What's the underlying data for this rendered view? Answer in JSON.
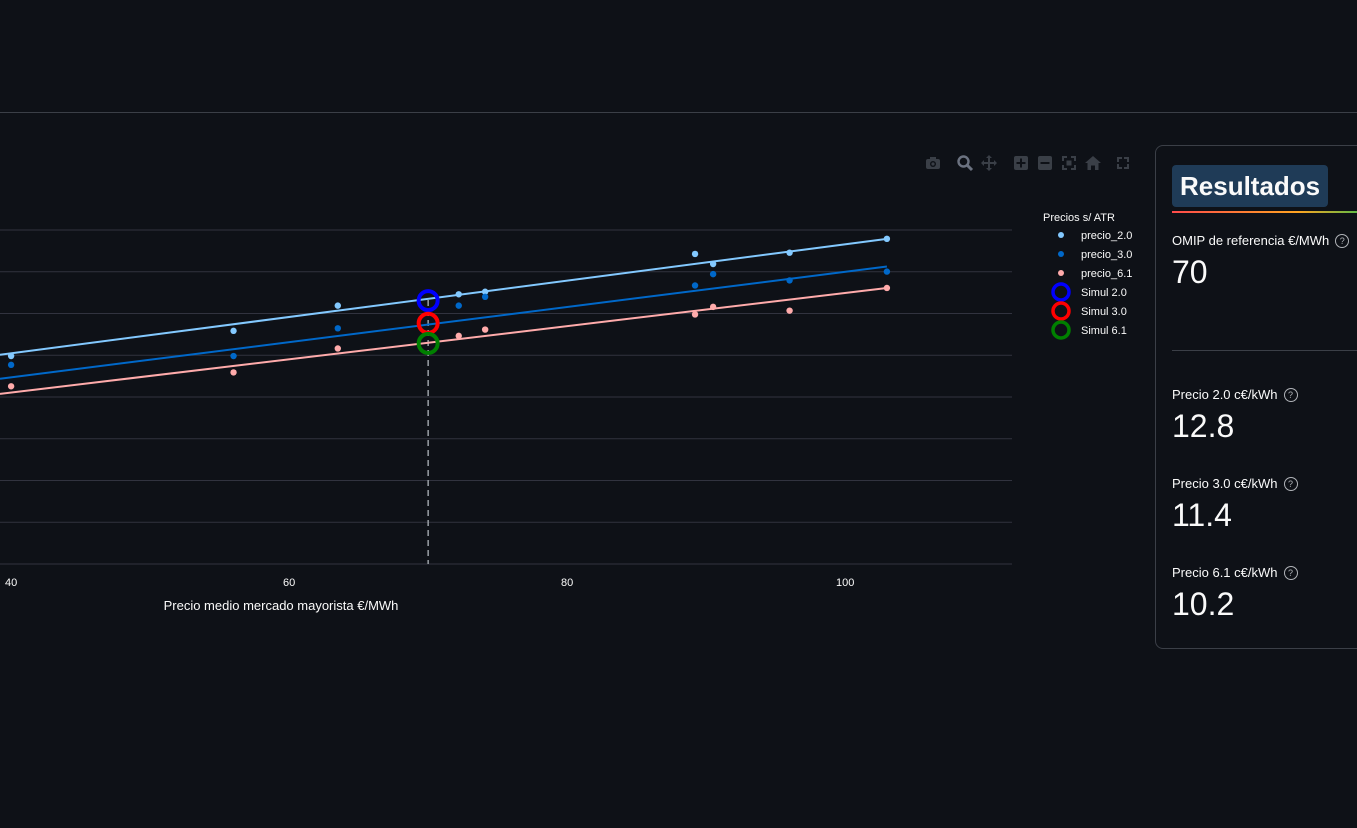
{
  "chart_data": {
    "type": "scatter",
    "xlabel": "Precio medio mercado mayorista €/MWh",
    "xticks": [
      40,
      60,
      80,
      100
    ],
    "xlim": [
      39.2,
      112
    ],
    "ylim": [
      -0.3,
      26.2
    ],
    "legend": {
      "title": "Precios s/ ATR",
      "placement": "right"
    },
    "series": [
      {
        "name": "precio_2.0",
        "color": "#83c9ff",
        "mode": "markers",
        "x": [
          40,
          56,
          63.5,
          72.2,
          74.1,
          89.2,
          90.5,
          96,
          103
        ],
        "y": [
          16.2,
          18.2,
          20.2,
          21.1,
          21.3,
          24.3,
          23.5,
          24.4,
          25.5
        ]
      },
      {
        "name": "precio_3.0",
        "color": "#0068c9",
        "mode": "markers",
        "x": [
          40,
          56,
          63.5,
          72.2,
          74.1,
          89.2,
          90.5,
          96,
          103
        ],
        "y": [
          15.5,
          16.2,
          18.4,
          20.2,
          20.9,
          21.8,
          22.7,
          22.2,
          22.9
        ]
      },
      {
        "name": "precio_6.1",
        "color": "#ffabab",
        "mode": "markers",
        "x": [
          40,
          56,
          63.5,
          72.2,
          74.1,
          89.2,
          90.5,
          96,
          103
        ],
        "y": [
          13.8,
          14.9,
          16.8,
          17.8,
          18.3,
          19.5,
          20.1,
          19.8,
          21.6
        ]
      },
      {
        "name": "",
        "color": "#83c9ff",
        "mode": "line",
        "x": [
          39.2,
          103
        ],
        "y": [
          16.3,
          25.5
        ]
      },
      {
        "name": "",
        "color": "#0068c9",
        "mode": "line",
        "x": [
          39.2,
          103
        ],
        "y": [
          14.4,
          23.3
        ]
      },
      {
        "name": "",
        "color": "#ffabab",
        "mode": "line",
        "x": [
          39.2,
          103
        ],
        "y": [
          13.2,
          21.6
        ]
      },
      {
        "name": "Simul 2.0",
        "color": "#0000ff",
        "mode": "ring",
        "x": [
          70
        ],
        "y": [
          20.6
        ]
      },
      {
        "name": "Simul 3.0",
        "color": "#ff0000",
        "mode": "ring",
        "x": [
          70
        ],
        "y": [
          18.8
        ]
      },
      {
        "name": "Simul 6.1",
        "color": "#008000",
        "mode": "ring",
        "x": [
          70
        ],
        "y": [
          17.2
        ]
      }
    ],
    "reference_line": {
      "x": 70,
      "style": "dashed",
      "color": "#9aa0a6"
    },
    "grid": true
  },
  "modebar": {
    "icons": [
      "camera-icon",
      "zoom-icon",
      "pan-icon",
      "zoom-in-icon",
      "zoom-out-icon",
      "autoscale-icon",
      "home-icon",
      "fullscreen-icon"
    ]
  },
  "results": {
    "title": "Resultados",
    "omip": {
      "label": "OMIP de referencia €/MWh",
      "value": "70"
    },
    "metrics": [
      {
        "label": "Precio 2.0 c€/kWh",
        "value": "12.8"
      },
      {
        "label": "Precio 3.0 c€/kWh",
        "value": "11.4"
      },
      {
        "label": "Precio 6.1 c€/kWh",
        "value": "10.2"
      }
    ],
    "help_glyph": "?"
  }
}
